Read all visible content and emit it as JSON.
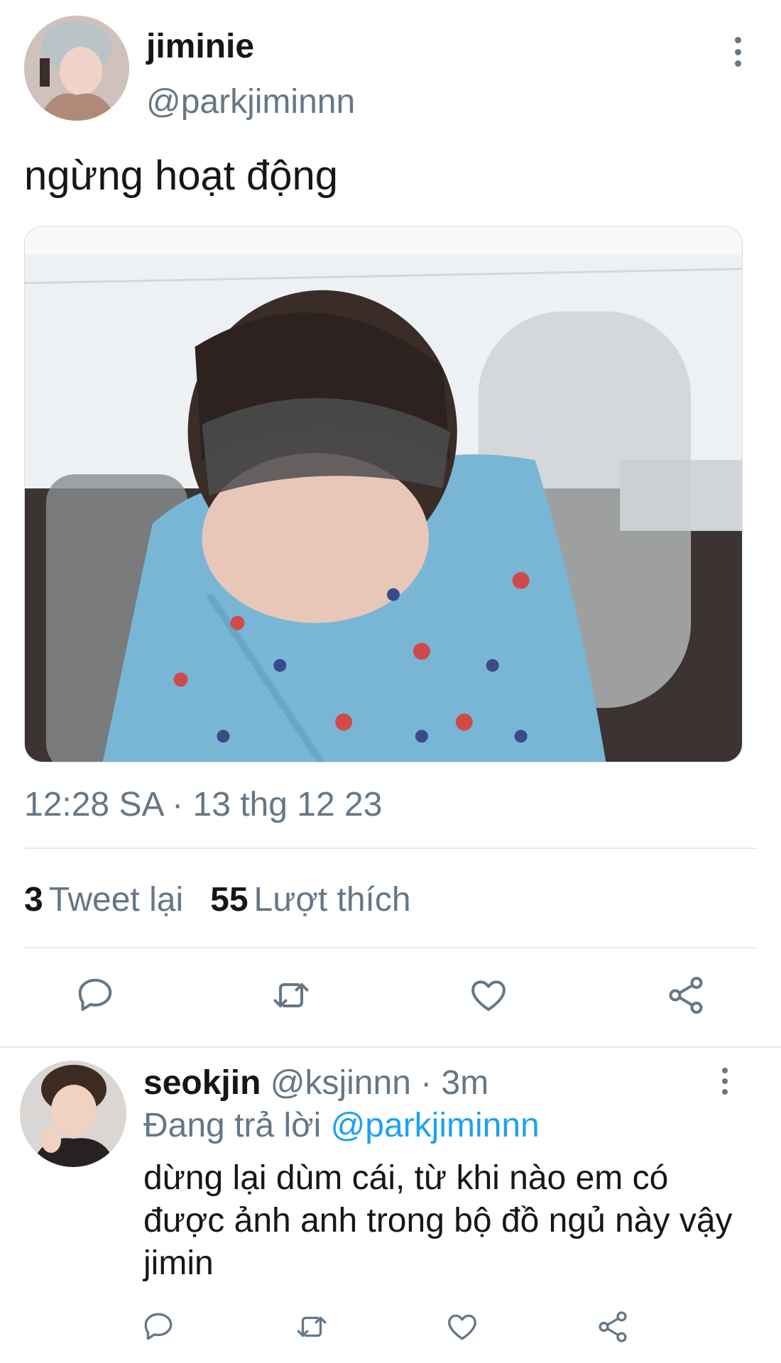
{
  "tweet": {
    "display_name": "jiminie",
    "handle": "@parkjiminnn",
    "text": "ngừng hoạt động",
    "timestamp": "12:28 SA · 13 thg 12 23",
    "retweet_count": "3",
    "retweet_label": "Tweet lại",
    "like_count": "55",
    "like_label": "Lượt thích",
    "avatar_icon": "user-avatar-photo",
    "media_icon": "photo-person-in-blue-pajamas"
  },
  "actions": [
    "reply-icon",
    "retweet-icon",
    "like-icon",
    "share-icon"
  ],
  "reply": {
    "display_name": "seokjin",
    "meta": " @ksjinnn · 3m",
    "replying_label": "Đang trả lời ",
    "replying_to": "@parkjiminnn",
    "text": "dừng lại dùm cái, từ khi nào em có được ảnh anh trong bộ đồ ngủ này vậy jimin",
    "avatar_icon": "user-avatar-photo"
  },
  "colors": {
    "text_primary": "#14171a",
    "text_secondary": "#657786",
    "accent": "#1da1f2",
    "divider": "#e6ecf0"
  }
}
